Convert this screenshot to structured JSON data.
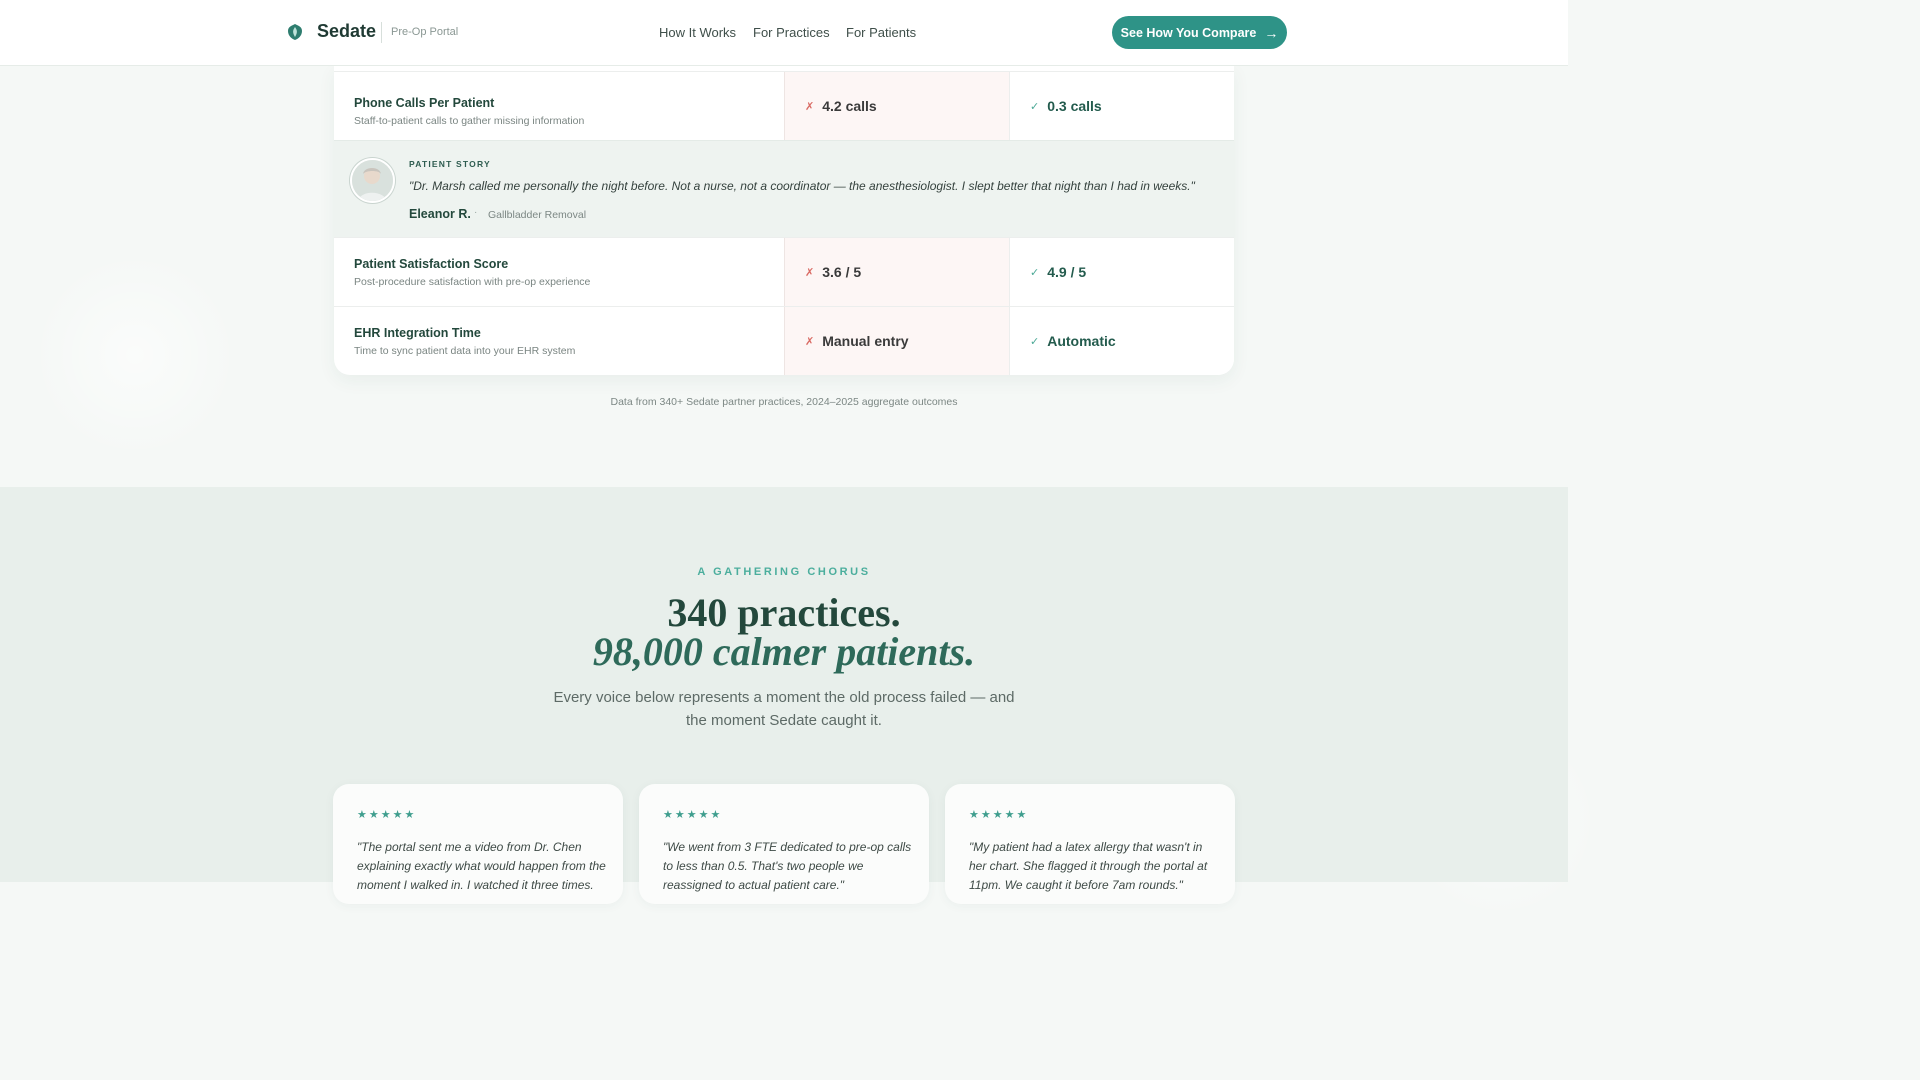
{
  "header": {
    "brand": "Sedate",
    "brand_sub": "Pre-Op Portal",
    "nav": [
      "How It Works",
      "For Practices",
      "For Patients"
    ],
    "cta_label": "See How You Compare"
  },
  "comparison": {
    "rows": [
      {
        "label": "Phone Calls Per Patient",
        "desc": "Staff-to-patient calls to gather missing information",
        "old_value": "4.2 calls",
        "new_value": "0.3 calls"
      },
      {
        "label": "Patient Satisfaction Score",
        "desc": "Post-procedure satisfaction with pre-op experience",
        "old_value": "3.6 / 5",
        "new_value": "4.9 / 5"
      },
      {
        "label": "EHR Integration Time",
        "desc": "Time to sync patient data into your EHR system",
        "old_value": "Manual entry",
        "new_value": "Automatic"
      }
    ],
    "story": {
      "kicker": "PATIENT STORY",
      "quote": "\"Dr. Marsh called me personally the night before. Not a nurse, not a coordinator — the anesthesiologist. I slept better that night than I had in weeks.\"",
      "name": "Eleanor R.",
      "procedure": "Gallbladder Removal"
    },
    "note": "Data from 340+ Sedate partner practices, 2024–2025 aggregate outcomes"
  },
  "chorus": {
    "kicker": "A GATHERING CHORUS",
    "headline_1": "340 practices.",
    "headline_2": "98,000 calmer patients.",
    "subtitle": "Every voice below represents a moment the old process failed — and the moment Sedate caught it.",
    "cards": [
      {
        "stars": "★★★★★",
        "quote": "\"The portal sent me a video from Dr. Chen explaining exactly what would happen from the moment I walked in. I watched it three times."
      },
      {
        "stars": "★★★★★",
        "quote": "\"We went from 3 FTE dedicated to pre-op calls to less than 0.5. That's two people we reassigned to actual patient care.\""
      },
      {
        "stars": "★★★★★",
        "quote": "\"My patient had a latex allergy that wasn't in her chart. She flagged it through the portal at 11pm. We caught it before 7am rounds.\""
      }
    ]
  },
  "colors": {
    "accent": "#2e9387",
    "accent_light": "#4bae9d",
    "ink": "#23483c",
    "negative": "#d96a63"
  },
  "icons": {
    "logo": "leaf-shield-icon",
    "cta": "arrow-right-icon",
    "negative": "cross-icon",
    "positive": "check-icon",
    "rating": "star-icon"
  }
}
